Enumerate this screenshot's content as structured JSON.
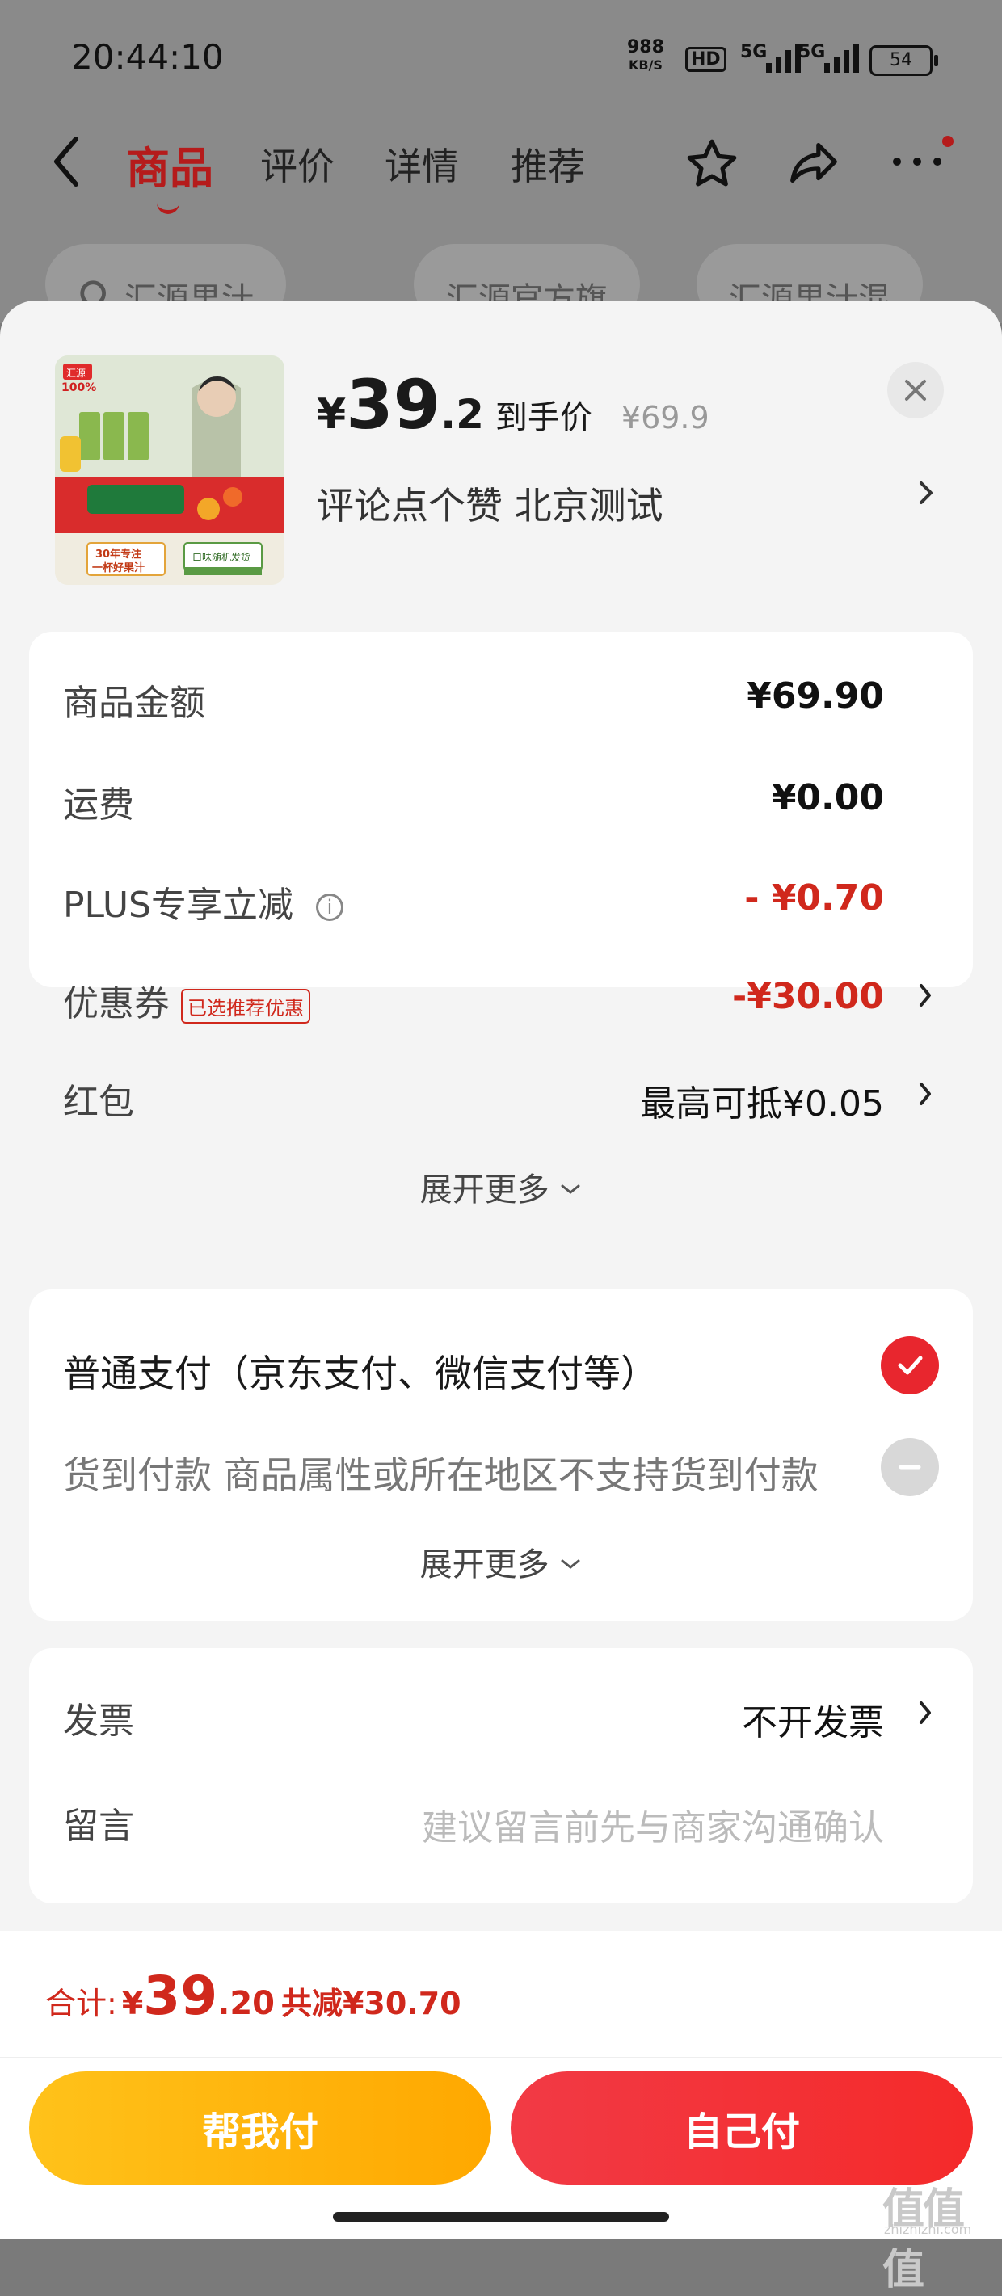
{
  "status_bar": {
    "time": "20:44:10",
    "speed_value": "988",
    "speed_unit": "KB/S",
    "hd": "HD",
    "sig1": "5G",
    "sig2": "5G",
    "battery": "54"
  },
  "nav": {
    "tabs": [
      "商品",
      "评价",
      "详情",
      "推荐"
    ],
    "active_tab": "商品"
  },
  "search_chips": [
    "汇源果汁",
    "汇源官方旗",
    "汇源果汁混"
  ],
  "product": {
    "price_yen": "¥",
    "price_int": "39",
    "price_dec": ".2",
    "price_label": "到手价",
    "original_price": "¥69.9",
    "spec": "评论点个赞  北京测试",
    "image_texts": {
      "brand": "汇源",
      "pct": "100%",
      "slogan1": "30年专注",
      "slogan2": "一杯好果汁",
      "promo": "口味随机发货"
    }
  },
  "breakdown": {
    "rows": [
      {
        "label": "商品金额",
        "value": "¥69.90"
      },
      {
        "label": "运费",
        "value": "¥0.00"
      },
      {
        "label": "PLUS专享立减",
        "value": "- ¥0.70"
      },
      {
        "label": "优惠券",
        "tag": "已选推荐优惠",
        "value": "-¥30.00"
      },
      {
        "label": "红包",
        "value": "最高可抵¥0.05"
      }
    ],
    "expand": "展开更多"
  },
  "payment": {
    "option1": "普通支付（京东支付、微信支付等）",
    "option2": "货到付款 商品属性或所在地区不支持货到付款",
    "expand": "展开更多"
  },
  "extra": {
    "invoice_label": "发票",
    "invoice_value": "不开发票",
    "note_label": "留言",
    "note_placeholder": "建议留言前先与商家沟通确认"
  },
  "footer": {
    "total_label": "合计:",
    "total_yen": "¥",
    "total_int": "39",
    "total_dec": ".20",
    "savings": "共减¥30.70",
    "help_pay": "帮我付",
    "self_pay": "自己付"
  },
  "watermark": {
    "text": "值值值",
    "url": "zhizhizhi.com"
  },
  "colors": {
    "accent_red": "#d0281c",
    "check_red": "#e8262e",
    "help_yellow": "#ffb800"
  }
}
